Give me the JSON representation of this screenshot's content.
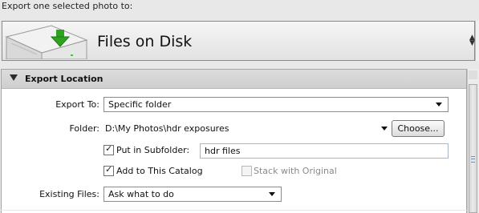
{
  "header": {
    "title": "Export one selected photo to:"
  },
  "destination": {
    "label": "Files on Disk",
    "icon": "hard-drive-icon"
  },
  "section": {
    "title": "Export Location",
    "expanded": true
  },
  "form": {
    "export_to": {
      "label": "Export To:",
      "value": "Specific folder"
    },
    "folder": {
      "label": "Folder:",
      "path": "D:\\My Photos\\hdr exposures",
      "choose_label": "Choose..."
    },
    "subfolder": {
      "label": "Put in Subfolder:",
      "checked": true,
      "value": "hdr files"
    },
    "catalog": {
      "label": "Add to This Catalog",
      "checked": true
    },
    "stack": {
      "label": "Stack with Original",
      "checked": false,
      "enabled": false
    },
    "existing_files": {
      "label": "Existing Files:",
      "value": "Ask what to do"
    }
  }
}
